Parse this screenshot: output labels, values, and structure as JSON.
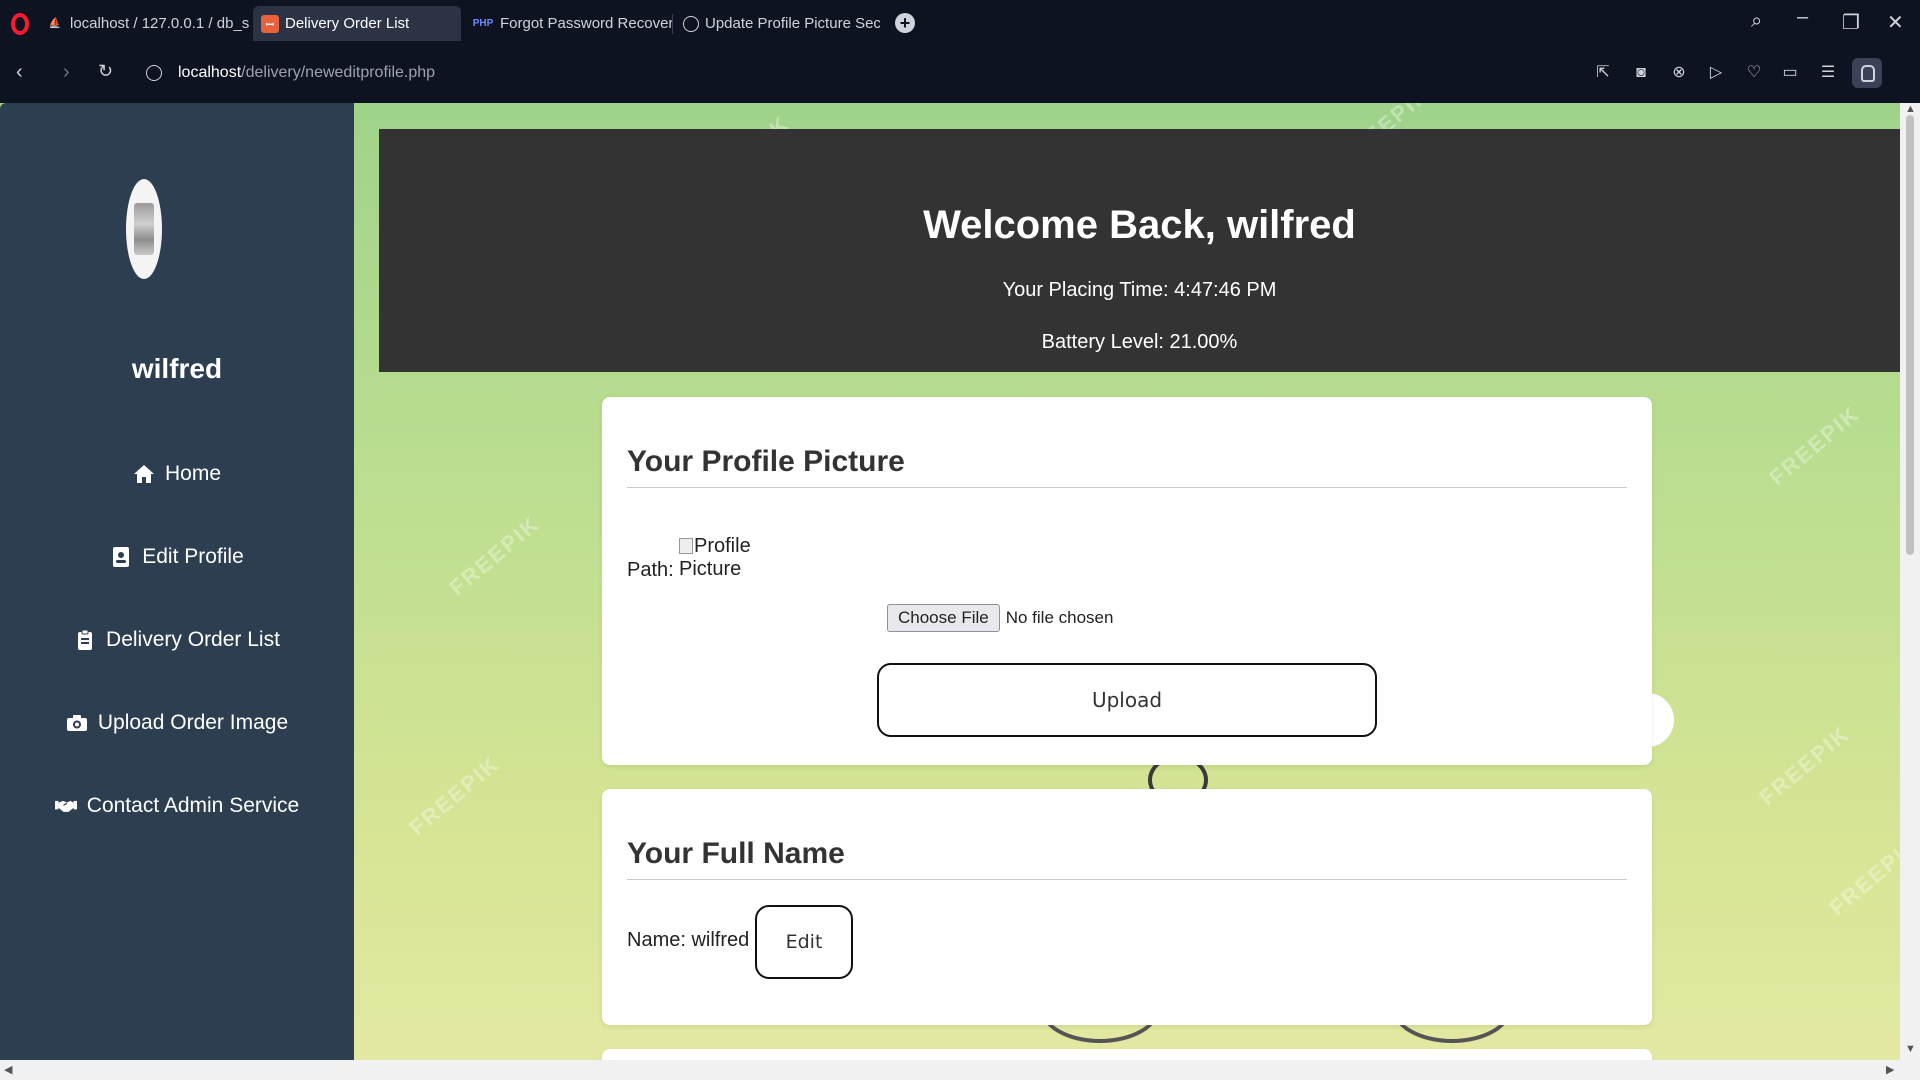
{
  "browser": {
    "tabs": [
      {
        "label": "localhost / 127.0.0.1 / db_s",
        "favicon": "phpmyadmin-icon",
        "active": false
      },
      {
        "label": "Delivery Order List",
        "favicon": "app-icon",
        "active": true
      },
      {
        "label": "Forgot Password Recovery",
        "favicon": "php-icon",
        "favicon_text": "PHP",
        "active": false
      },
      {
        "label": "Update Profile Picture Sec",
        "favicon": "chatgpt-icon",
        "active": false
      }
    ],
    "url_host": "localhost",
    "url_path": "/delivery/neweditprofile.php"
  },
  "sidebar": {
    "username": "wilfred",
    "items": [
      {
        "label": "Home",
        "icon": "home-icon"
      },
      {
        "label": "Edit Profile",
        "icon": "id-badge-icon"
      },
      {
        "label": "Delivery Order List",
        "icon": "clipboard-icon"
      },
      {
        "label": "Upload Order Image",
        "icon": "camera-icon"
      },
      {
        "label": "Contact Admin Service",
        "icon": "handshake-icon"
      }
    ]
  },
  "header": {
    "welcome": "Welcome Back, wilfred",
    "placing_time": "Your Placing Time: 4:47:46 PM",
    "battery": "Battery Level: 21.00%"
  },
  "profile_picture": {
    "title": "Your Profile Picture",
    "path_label": "Path:",
    "img_alt_line1": "Profile",
    "img_alt_line2": "Picture",
    "choose_file": "Choose File",
    "no_file": "No file chosen",
    "upload": "Upload"
  },
  "full_name": {
    "title": "Your Full Name",
    "name_label": "Name: wilfred",
    "edit": "Edit"
  },
  "watermark_text": "FREEPIK",
  "colors": {
    "sidebar_bg": "#2c3e50",
    "header_bg": "#333333",
    "browser_bg": "#0e1321"
  }
}
